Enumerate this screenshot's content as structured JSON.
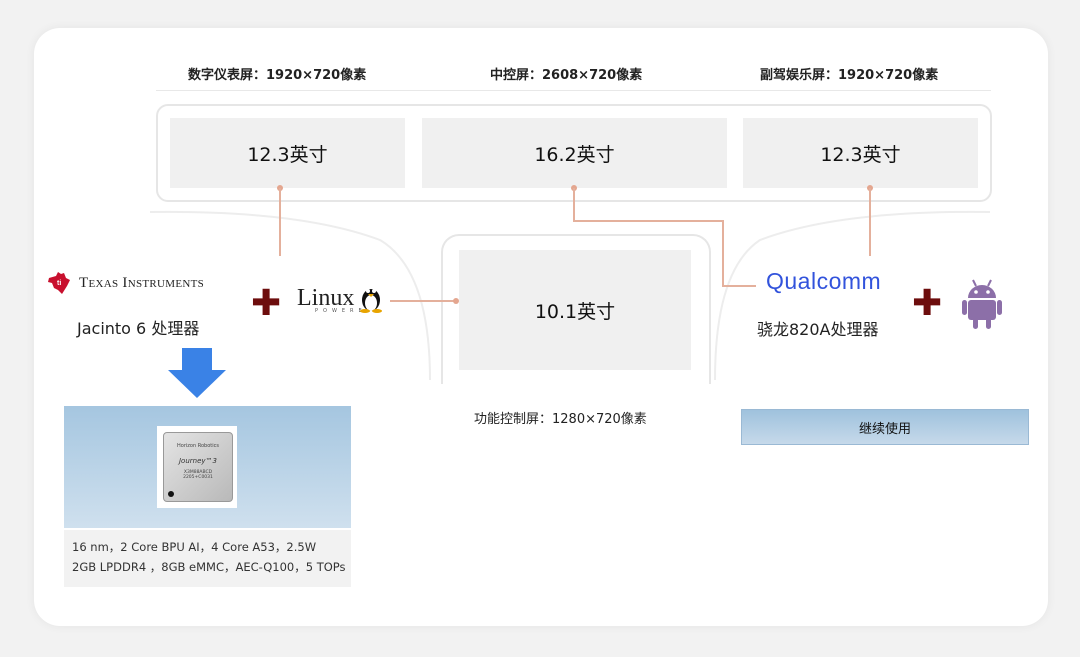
{
  "headers": {
    "cluster": "数字仪表屏：1920×720像素",
    "center": "中控屏：2608×720像素",
    "passenger": "副驾娱乐屏：1920×720像素",
    "control": "功能控制屏：1280×720像素"
  },
  "screens": {
    "cluster": "12.3英寸",
    "center": "16.2英寸",
    "passenger": "12.3英寸",
    "control": "10.1英寸"
  },
  "left": {
    "brand": "Texas Instruments",
    "processor": "Jacinto 6 处理器",
    "os": "Linux",
    "os_sub": "POWERED",
    "chip_brand": "Horizon Robotics",
    "chip_name": "Journey™3",
    "chip_code": "X3M88ABCD",
    "chip_code2": "2205+C0031",
    "specs": [
      "16 nm，2 Core BPU AI，4 Core A53，2.5W",
      "2GB LPDDR4 ，8GB eMMC，AEC-Q100，5 TOPs"
    ]
  },
  "right": {
    "brand": "Qualcomm",
    "processor": "骁龙820A处理器",
    "status": "继续使用"
  },
  "colors": {
    "connector": "#e4b09c",
    "plus": "#6d0d0d",
    "arrow": "#3a82e6",
    "android": "#8c6fa8"
  }
}
